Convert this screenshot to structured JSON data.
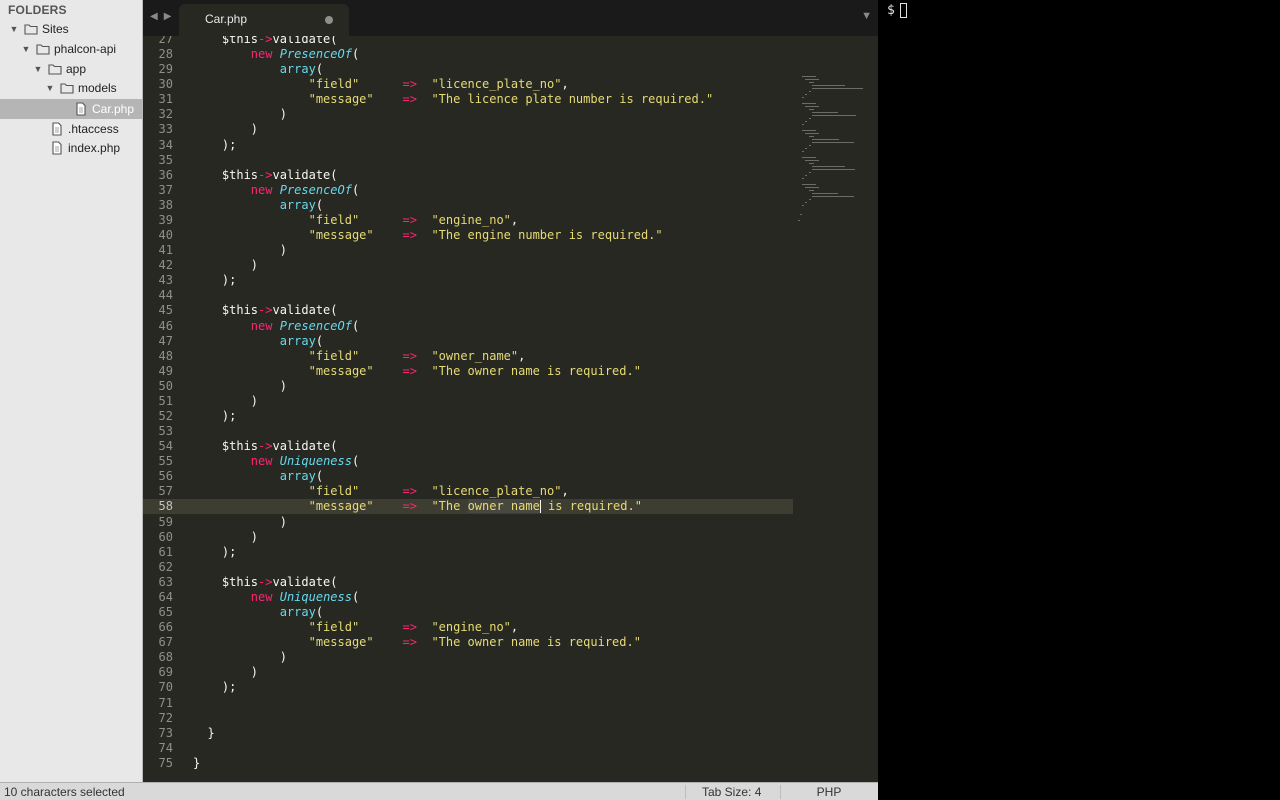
{
  "sidebar": {
    "header": "FOLDERS",
    "items": [
      {
        "label": "Sites",
        "type": "folder",
        "expanded": true,
        "depth": 0
      },
      {
        "label": "phalcon-api",
        "type": "folder",
        "expanded": true,
        "depth": 1
      },
      {
        "label": "app",
        "type": "folder",
        "expanded": true,
        "depth": 2
      },
      {
        "label": "models",
        "type": "folder",
        "expanded": true,
        "depth": 3
      },
      {
        "label": "Car.php",
        "type": "file",
        "selected": true,
        "depth": 4
      },
      {
        "label": ".htaccess",
        "type": "file",
        "depth": 2
      },
      {
        "label": "index.php",
        "type": "file",
        "depth": 2
      }
    ]
  },
  "tabs": [
    {
      "title": "Car.php",
      "modified": true,
      "active": true
    }
  ],
  "editor": {
    "current_line": 58,
    "lines": [
      {
        "n": "27",
        "t": [
          [
            "    ",
            ""
          ],
          [
            "$this",
            "var"
          ],
          [
            "->",
            "op"
          ],
          [
            "validate(",
            "fn"
          ]
        ]
      },
      {
        "n": "28",
        "t": [
          [
            "        ",
            ""
          ],
          [
            "new",
            "kw"
          ],
          [
            " ",
            ""
          ],
          [
            "PresenceOf",
            "cls"
          ],
          [
            "(",
            ""
          ]
        ]
      },
      {
        "n": "29",
        "t": [
          [
            "            ",
            ""
          ],
          [
            "array",
            "bi"
          ],
          [
            "(",
            ""
          ]
        ]
      },
      {
        "n": "30",
        "t": [
          [
            "                ",
            ""
          ],
          [
            "\"field\"",
            "str"
          ],
          [
            "      ",
            ""
          ],
          [
            "=>",
            "op"
          ],
          [
            "  ",
            ""
          ],
          [
            "\"licence_plate_no\"",
            "str"
          ],
          [
            ",",
            ""
          ]
        ]
      },
      {
        "n": "31",
        "t": [
          [
            "                ",
            ""
          ],
          [
            "\"message\"",
            "str"
          ],
          [
            "    ",
            ""
          ],
          [
            "=>",
            "op"
          ],
          [
            "  ",
            ""
          ],
          [
            "\"The licence plate number is required.\"",
            "str"
          ]
        ]
      },
      {
        "n": "32",
        "t": [
          [
            "            )",
            ""
          ]
        ]
      },
      {
        "n": "33",
        "t": [
          [
            "        )",
            ""
          ]
        ]
      },
      {
        "n": "34",
        "t": [
          [
            "    );",
            ""
          ]
        ]
      },
      {
        "n": "35",
        "t": [
          [
            "",
            ""
          ]
        ]
      },
      {
        "n": "36",
        "t": [
          [
            "    ",
            ""
          ],
          [
            "$this",
            "var"
          ],
          [
            "->",
            "op"
          ],
          [
            "validate(",
            "fn"
          ]
        ]
      },
      {
        "n": "37",
        "t": [
          [
            "        ",
            ""
          ],
          [
            "new",
            "kw"
          ],
          [
            " ",
            ""
          ],
          [
            "PresenceOf",
            "cls"
          ],
          [
            "(",
            ""
          ]
        ]
      },
      {
        "n": "38",
        "t": [
          [
            "            ",
            ""
          ],
          [
            "array",
            "bi"
          ],
          [
            "(",
            ""
          ]
        ]
      },
      {
        "n": "39",
        "t": [
          [
            "                ",
            ""
          ],
          [
            "\"field\"",
            "str"
          ],
          [
            "      ",
            ""
          ],
          [
            "=>",
            "op"
          ],
          [
            "  ",
            ""
          ],
          [
            "\"engine_no\"",
            "str"
          ],
          [
            ",",
            ""
          ]
        ]
      },
      {
        "n": "40",
        "t": [
          [
            "                ",
            ""
          ],
          [
            "\"message\"",
            "str"
          ],
          [
            "    ",
            ""
          ],
          [
            "=>",
            "op"
          ],
          [
            "  ",
            ""
          ],
          [
            "\"The engine number is required.\"",
            "str"
          ]
        ]
      },
      {
        "n": "41",
        "t": [
          [
            "            )",
            ""
          ]
        ]
      },
      {
        "n": "42",
        "t": [
          [
            "        )",
            ""
          ]
        ]
      },
      {
        "n": "43",
        "t": [
          [
            "    );",
            ""
          ]
        ]
      },
      {
        "n": "44",
        "t": [
          [
            "",
            ""
          ]
        ]
      },
      {
        "n": "45",
        "t": [
          [
            "    ",
            ""
          ],
          [
            "$this",
            "var"
          ],
          [
            "->",
            "op"
          ],
          [
            "validate(",
            "fn"
          ]
        ]
      },
      {
        "n": "46",
        "t": [
          [
            "        ",
            ""
          ],
          [
            "new",
            "kw"
          ],
          [
            " ",
            ""
          ],
          [
            "PresenceOf",
            "cls"
          ],
          [
            "(",
            ""
          ]
        ]
      },
      {
        "n": "47",
        "t": [
          [
            "            ",
            ""
          ],
          [
            "array",
            "bi"
          ],
          [
            "(",
            ""
          ]
        ]
      },
      {
        "n": "48",
        "t": [
          [
            "                ",
            ""
          ],
          [
            "\"field\"",
            "str"
          ],
          [
            "      ",
            ""
          ],
          [
            "=>",
            "op"
          ],
          [
            "  ",
            ""
          ],
          [
            "\"owner_name\"",
            "str"
          ],
          [
            ",",
            ""
          ]
        ]
      },
      {
        "n": "49",
        "t": [
          [
            "                ",
            ""
          ],
          [
            "\"message\"",
            "str"
          ],
          [
            "    ",
            ""
          ],
          [
            "=>",
            "op"
          ],
          [
            "  ",
            ""
          ],
          [
            "\"The owner name is required.\"",
            "str"
          ]
        ]
      },
      {
        "n": "50",
        "t": [
          [
            "            )",
            ""
          ]
        ]
      },
      {
        "n": "51",
        "t": [
          [
            "        )",
            ""
          ]
        ]
      },
      {
        "n": "52",
        "t": [
          [
            "    );",
            ""
          ]
        ]
      },
      {
        "n": "53",
        "t": [
          [
            "",
            ""
          ]
        ]
      },
      {
        "n": "54",
        "t": [
          [
            "    ",
            ""
          ],
          [
            "$this",
            "var"
          ],
          [
            "->",
            "op"
          ],
          [
            "validate(",
            "fn"
          ]
        ]
      },
      {
        "n": "55",
        "t": [
          [
            "        ",
            ""
          ],
          [
            "new",
            "kw"
          ],
          [
            " ",
            ""
          ],
          [
            "Uniqueness",
            "cls"
          ],
          [
            "(",
            ""
          ]
        ]
      },
      {
        "n": "56",
        "t": [
          [
            "            ",
            ""
          ],
          [
            "array",
            "bi"
          ],
          [
            "(",
            ""
          ]
        ]
      },
      {
        "n": "57",
        "t": [
          [
            "                ",
            ""
          ],
          [
            "\"field\"",
            "str"
          ],
          [
            "      ",
            ""
          ],
          [
            "=>",
            "op"
          ],
          [
            "  ",
            ""
          ],
          [
            "\"licence_plate_no\"",
            "str"
          ],
          [
            ",",
            ""
          ]
        ]
      },
      {
        "n": "58",
        "t": [
          [
            "                ",
            ""
          ],
          [
            "\"message\"",
            "str"
          ],
          [
            "    ",
            ""
          ],
          [
            "=>",
            "op"
          ],
          [
            "  ",
            ""
          ],
          [
            "\"The ",
            "str"
          ],
          [
            "owner name",
            "str hl"
          ],
          [
            "|",
            "caret"
          ],
          [
            " is required.\"",
            "str"
          ]
        ]
      },
      {
        "n": "59",
        "t": [
          [
            "            )",
            ""
          ]
        ]
      },
      {
        "n": "60",
        "t": [
          [
            "        )",
            ""
          ]
        ]
      },
      {
        "n": "61",
        "t": [
          [
            "    );",
            ""
          ]
        ]
      },
      {
        "n": "62",
        "t": [
          [
            "",
            ""
          ]
        ]
      },
      {
        "n": "63",
        "t": [
          [
            "    ",
            ""
          ],
          [
            "$this",
            "var"
          ],
          [
            "->",
            "op"
          ],
          [
            "validate(",
            "fn"
          ]
        ]
      },
      {
        "n": "64",
        "t": [
          [
            "        ",
            ""
          ],
          [
            "new",
            "kw"
          ],
          [
            " ",
            ""
          ],
          [
            "Uniqueness",
            "cls"
          ],
          [
            "(",
            ""
          ]
        ]
      },
      {
        "n": "65",
        "t": [
          [
            "            ",
            ""
          ],
          [
            "array",
            "bi"
          ],
          [
            "(",
            ""
          ]
        ]
      },
      {
        "n": "66",
        "t": [
          [
            "                ",
            ""
          ],
          [
            "\"field\"",
            "str"
          ],
          [
            "      ",
            ""
          ],
          [
            "=>",
            "op"
          ],
          [
            "  ",
            ""
          ],
          [
            "\"engine_no\"",
            "str"
          ],
          [
            ",",
            ""
          ]
        ]
      },
      {
        "n": "67",
        "t": [
          [
            "                ",
            ""
          ],
          [
            "\"message\"",
            "str"
          ],
          [
            "    ",
            ""
          ],
          [
            "=>",
            "op"
          ],
          [
            "  ",
            ""
          ],
          [
            "\"The owner name is required.\"",
            "str"
          ]
        ]
      },
      {
        "n": "68",
        "t": [
          [
            "            )",
            ""
          ]
        ]
      },
      {
        "n": "69",
        "t": [
          [
            "        )",
            ""
          ]
        ]
      },
      {
        "n": "70",
        "t": [
          [
            "    );",
            ""
          ]
        ]
      },
      {
        "n": "71",
        "t": [
          [
            "",
            ""
          ]
        ]
      },
      {
        "n": "72",
        "t": [
          [
            "",
            ""
          ]
        ]
      },
      {
        "n": "73",
        "t": [
          [
            "  }",
            ""
          ]
        ]
      },
      {
        "n": "74",
        "t": [
          [
            "",
            ""
          ]
        ]
      },
      {
        "n": "75",
        "t": [
          [
            "}",
            ""
          ]
        ]
      }
    ]
  },
  "statusbar": {
    "selection": "10 characters selected",
    "tab_size": "Tab Size: 4",
    "syntax": "PHP"
  },
  "terminal": {
    "prompt": "$"
  },
  "colors": {
    "editor_bg": "#272822",
    "keyword": "#f92672",
    "string": "#e6db74",
    "class": "#66d9ef"
  }
}
